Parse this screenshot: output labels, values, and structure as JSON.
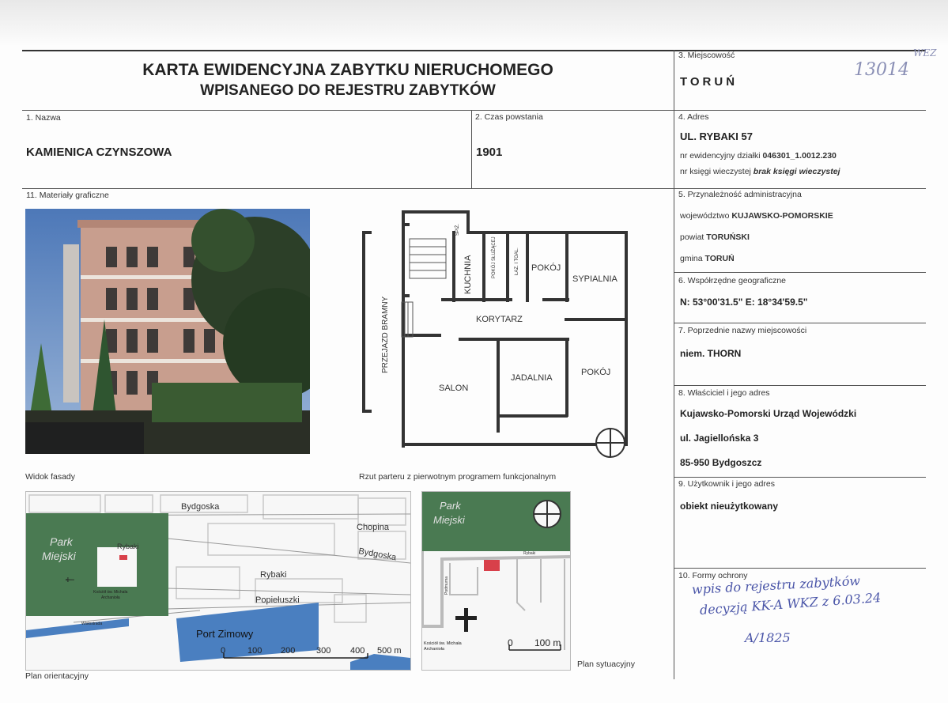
{
  "header": {
    "title_line1": "KARTA EWIDENCYJNA ZABYTKU NIERUCHOMEGO",
    "title_line2": "WPISANEGO DO REJESTRU ZABYTKÓW"
  },
  "field1": {
    "label": "1. Nazwa",
    "value": "KAMIENICA CZYNSZOWA"
  },
  "field2": {
    "label": "2. Czas powstania",
    "value": "1901"
  },
  "field3": {
    "label": "3. Miejscowość",
    "value": "TORUŃ",
    "handwritten": "13014",
    "stamp": "WEZ"
  },
  "field4": {
    "label": "4. Adres",
    "value": "UL. RYBAKI 57",
    "parcel_prefix": "nr ewidencyjny działki",
    "parcel_value": "046301_1.0012.230",
    "book_prefix": "nr księgi wieczystej",
    "book_value": "brak księgi wieczystej"
  },
  "field5": {
    "label": "5. Przynależność administracyjna",
    "woj_prefix": "województwo",
    "woj_value": "KUJAWSKO-POMORSKIE",
    "powiat_prefix": "powiat",
    "powiat_value": "TORUŃSKI",
    "gmina_prefix": "gmina",
    "gmina_value": "TORUŃ"
  },
  "field6": {
    "label": "6. Współrzędne geograficzne",
    "value": "N: 53°00'31.5\" E: 18°34'59.5\""
  },
  "field7": {
    "label": "7. Poprzednie nazwy miejscowości",
    "value": "niem. THORN"
  },
  "field8": {
    "label": "8. Właściciel i jego adres",
    "line1": "Kujawsko-Pomorski Urząd Wojewódzki",
    "line2": "ul. Jagiellońska 3",
    "line3": "85-950 Bydgoszcz"
  },
  "field9": {
    "label": "9. Użytkownik i jego adres",
    "value": "obiekt nieużytkowany"
  },
  "field10": {
    "label": "10. Formy ochrony",
    "hand_line1": "wpis do rejestru zabytków",
    "hand_line2": "decyzją KK-A WKZ z 6.03.24",
    "hand_line3": "A/1825"
  },
  "field11": {
    "label": "11. Materiały graficzne",
    "caption_photo": "Widok fasady",
    "caption_plan": "Rzut parteru z pierwotnym programem funkcjonalnym",
    "caption_map1": "Plan orientacyjny",
    "caption_map2": "Plan sytuacyjny"
  },
  "floorplan": {
    "rooms": {
      "kuchnia": "KUCHNIA",
      "spiz": "SPIŻ.",
      "pokoj_sluzacej": "POKÓJ SŁUŻĄCEJ",
      "lazienka": "ŁAZ. I TOAL.",
      "pokoj1": "POKÓJ",
      "sypialnia": "SYPIALNIA",
      "korytarz": "KORYTARZ",
      "przejazd": "PRZEJAZD BRAMNY",
      "salon": "SALON",
      "jadalnia": "JADALNIA",
      "pokoj2": "POKÓJ"
    }
  },
  "map1": {
    "streets": [
      "Bydgoska",
      "Chopina",
      "Bydgoska",
      "Rybaki",
      "Rybaki",
      "Popiełuszki",
      "Wisłostrada"
    ],
    "park": [
      "Park",
      "Miejski"
    ],
    "church": [
      "Kościół św. Michała",
      "Archanioła"
    ],
    "port": "Port Zimowy",
    "scale": [
      "0",
      "100",
      "200",
      "300",
      "400",
      "500 m"
    ]
  },
  "map2": {
    "park": [
      "Park",
      "Miejski"
    ],
    "streets": [
      "Rybaki",
      "Podmurna"
    ],
    "church": [
      "Kościół św. Michała",
      "Archanioła"
    ],
    "scale": [
      "0",
      "100 m"
    ]
  },
  "colors": {
    "park": "#4a7a52",
    "water": "#4a7fc0",
    "building": "#d8404a",
    "ink": "#4a55a8"
  }
}
